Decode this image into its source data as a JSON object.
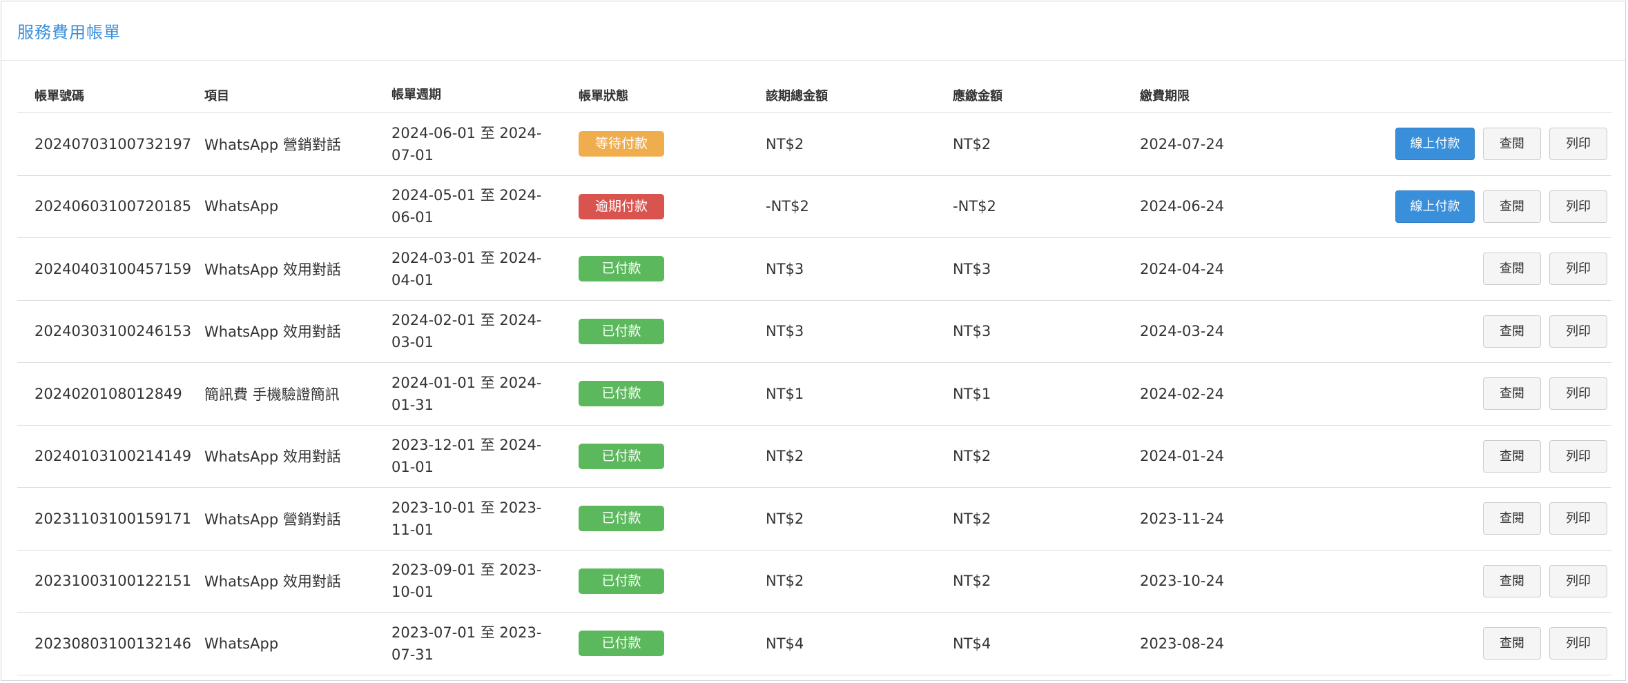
{
  "panel": {
    "title": "服務費用帳單"
  },
  "table": {
    "headers": {
      "bill_no": "帳單號碼",
      "item": "項目",
      "period": "帳單週期",
      "status": "帳單狀態",
      "total": "該期總金額",
      "amount_due": "應繳金額",
      "deadline": "繳費期限"
    },
    "actions": {
      "pay": "線上付款",
      "view": "查閱",
      "print": "列印"
    },
    "rows": [
      {
        "bill_no": "20240703100732197",
        "item": "WhatsApp 營銷對話",
        "period": "2024-06-01 至 2024-07-01",
        "status": "等待付款",
        "status_type": "pending",
        "total": "NT$2",
        "amount_due": "NT$2",
        "deadline": "2024-07-24",
        "payable": true
      },
      {
        "bill_no": "20240603100720185",
        "item": "WhatsApp",
        "period": "2024-05-01 至 2024-06-01",
        "status": "逾期付款",
        "status_type": "overdue",
        "total": "-NT$2",
        "amount_due": "-NT$2",
        "deadline": "2024-06-24",
        "payable": true
      },
      {
        "bill_no": "20240403100457159",
        "item": "WhatsApp 效用對話",
        "period": "2024-03-01 至 2024-04-01",
        "status": "已付款",
        "status_type": "paid",
        "total": "NT$3",
        "amount_due": "NT$3",
        "deadline": "2024-04-24",
        "payable": false
      },
      {
        "bill_no": "20240303100246153",
        "item": "WhatsApp 效用對話",
        "period": "2024-02-01 至 2024-03-01",
        "status": "已付款",
        "status_type": "paid",
        "total": "NT$3",
        "amount_due": "NT$3",
        "deadline": "2024-03-24",
        "payable": false
      },
      {
        "bill_no": "2024020108012849",
        "item": "簡訊費 手機驗證簡訊",
        "period": "2024-01-01 至 2024-01-31",
        "status": "已付款",
        "status_type": "paid",
        "total": "NT$1",
        "amount_due": "NT$1",
        "deadline": "2024-02-24",
        "payable": false
      },
      {
        "bill_no": "20240103100214149",
        "item": "WhatsApp 效用對話",
        "period": "2023-12-01 至 2024-01-01",
        "status": "已付款",
        "status_type": "paid",
        "total": "NT$2",
        "amount_due": "NT$2",
        "deadline": "2024-01-24",
        "payable": false
      },
      {
        "bill_no": "20231103100159171",
        "item": "WhatsApp 營銷對話",
        "period": "2023-10-01 至 2023-11-01",
        "status": "已付款",
        "status_type": "paid",
        "total": "NT$2",
        "amount_due": "NT$2",
        "deadline": "2023-11-24",
        "payable": false
      },
      {
        "bill_no": "20231003100122151",
        "item": "WhatsApp 效用對話",
        "period": "2023-09-01 至 2023-10-01",
        "status": "已付款",
        "status_type": "paid",
        "total": "NT$2",
        "amount_due": "NT$2",
        "deadline": "2023-10-24",
        "payable": false
      },
      {
        "bill_no": "20230803100132146",
        "item": "WhatsApp",
        "period": "2023-07-01 至 2023-07-31",
        "status": "已付款",
        "status_type": "paid",
        "total": "NT$4",
        "amount_due": "NT$4",
        "deadline": "2023-08-24",
        "payable": false
      }
    ]
  },
  "colors": {
    "title": "#3a8fdb",
    "primary_button": "#3a8fdb",
    "pending": "#f0ad4e",
    "overdue": "#d9534f",
    "paid": "#5cb85c"
  }
}
